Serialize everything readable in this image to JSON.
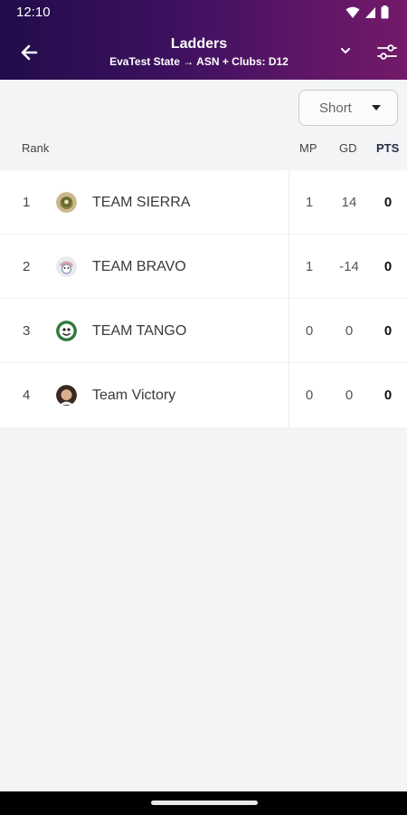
{
  "status_bar": {
    "time": "12:10"
  },
  "app_bar": {
    "title": "Ladders",
    "subtitle": "EvaTest State → ASN + Clubs: D12"
  },
  "sort": {
    "selected": "Short"
  },
  "columns": {
    "rank": "Rank",
    "mp": "MP",
    "gd": "GD",
    "pts": "PTS"
  },
  "rows": [
    {
      "rank": "1",
      "team": "TEAM SIERRA",
      "mp": "1",
      "gd": "14",
      "pts": "0",
      "logo_icon": "team-sierra-logo-icon"
    },
    {
      "rank": "2",
      "team": "TEAM BRAVO",
      "mp": "1",
      "gd": "-14",
      "pts": "0",
      "logo_icon": "team-bravo-logo-icon"
    },
    {
      "rank": "3",
      "team": "TEAM TANGO",
      "mp": "0",
      "gd": "0",
      "pts": "0",
      "logo_icon": "team-tango-logo-icon"
    },
    {
      "rank": "4",
      "team": "Team Victory",
      "mp": "0",
      "gd": "0",
      "pts": "0",
      "logo_icon": "team-victory-logo-icon"
    }
  ],
  "colors": {
    "header_gradient_start": "#210c4a",
    "header_gradient_end": "#731a69",
    "background": "#f3f4f6",
    "table_background": "#ffffff"
  }
}
